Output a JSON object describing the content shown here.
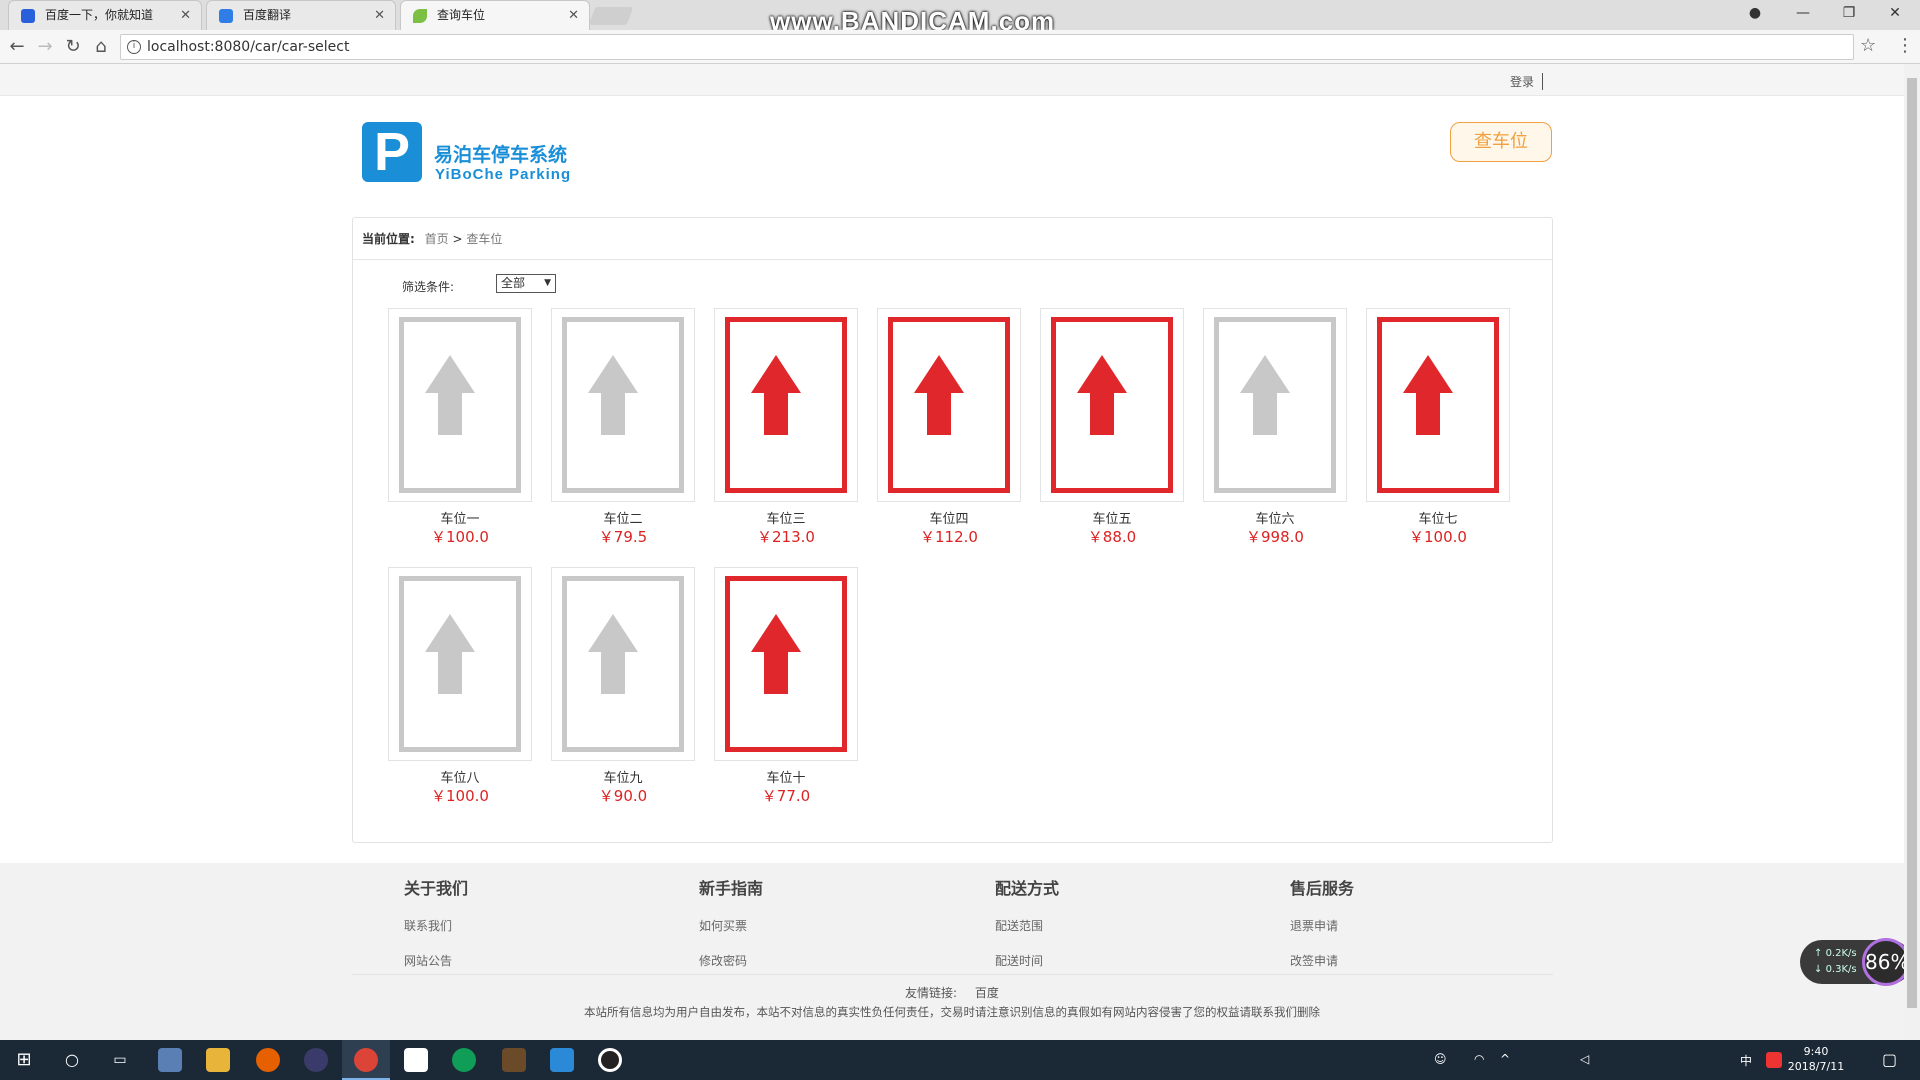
{
  "browser": {
    "tabs": [
      {
        "title": "百度一下，你就知道",
        "favicon_color": "#2a5fdb"
      },
      {
        "title": "百度翻译",
        "favicon_color": "#2f7ee8"
      },
      {
        "title": "查询车位",
        "favicon_color": "#7bc043",
        "active": true
      }
    ],
    "watermark": "www.BANDICAM.com",
    "url": "localhost:8080/car/car-select"
  },
  "header": {
    "login": "登录",
    "logo_letter": "P",
    "logo_cn": "易泊车停车系统",
    "logo_en": "YiBoChe Parking",
    "query_button": "查车位"
  },
  "breadcrumb": {
    "label": "当前位置:",
    "home": "首页",
    "separator": ">",
    "current": "查车位"
  },
  "filter": {
    "label": "筛选条件:",
    "selected": "全部"
  },
  "colors": {
    "occupied": "#e0282c",
    "free": "#c8c8c8",
    "price": "#dd2222",
    "brand": "#1a8fd8",
    "accent": "#f0a040"
  },
  "slots": [
    {
      "name": "车位一",
      "price": "￥100.0",
      "occupied": false
    },
    {
      "name": "车位二",
      "price": "￥79.5",
      "occupied": false
    },
    {
      "name": "车位三",
      "price": "￥213.0",
      "occupied": true
    },
    {
      "name": "车位四",
      "price": "￥112.0",
      "occupied": true
    },
    {
      "name": "车位五",
      "price": "￥88.0",
      "occupied": true
    },
    {
      "name": "车位六",
      "price": "￥998.0",
      "occupied": false
    },
    {
      "name": "车位七",
      "price": "￥100.0",
      "occupied": true
    },
    {
      "name": "车位八",
      "price": "￥100.0",
      "occupied": false
    },
    {
      "name": "车位九",
      "price": "￥90.0",
      "occupied": false
    },
    {
      "name": "车位十",
      "price": "￥77.0",
      "occupied": true
    }
  ],
  "footer": {
    "columns": [
      {
        "title": "关于我们",
        "links": [
          "联系我们",
          "网站公告"
        ]
      },
      {
        "title": "新手指南",
        "links": [
          "如何买票",
          "修改密码"
        ]
      },
      {
        "title": "配送方式",
        "links": [
          "配送范围",
          "配送时间"
        ]
      },
      {
        "title": "售后服务",
        "links": [
          "退票申请",
          "改签申请"
        ]
      }
    ],
    "friend_label": "友情链接:",
    "friend_link": "百度",
    "disclaimer": "本站所有信息均为用户自由发布，本站不对信息的真实性负任何责任，交易时请注意识别信息的真假如有网站内容侵害了您的权益请联系我们删除"
  },
  "speed_widget": {
    "up": "0.2K/s",
    "down": "0.3K/s",
    "percent": "86%"
  },
  "taskbar": {
    "time": "9:40",
    "date": "2018/7/11",
    "ime": "中"
  }
}
